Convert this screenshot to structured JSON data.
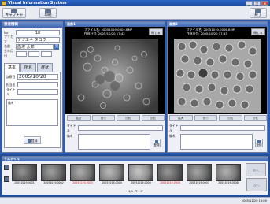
{
  "window": {
    "title": "Visual Information System",
    "buttons": {
      "minimize": "_",
      "maximize": "□",
      "close": "×"
    }
  },
  "toolbar": {
    "capture_label": "キャプチャ",
    "print_label": "印刷",
    "exit_label": "終了"
  },
  "patient": {
    "panel_title": "患者情報",
    "no_label": "No",
    "no_value": "18",
    "furigana_label": "フリガナ",
    "furigana_value": "ケツエキ タロウ",
    "name_label": "名前",
    "name_value": "血液 太郎",
    "gender": "男",
    "dob_label": "生年月日",
    "tabs": [
      "基本",
      "所見",
      "症状"
    ],
    "visit_label": "診察日",
    "visit_value": "2005/10/20",
    "physician_label": "担当医",
    "title_label": "タイトル",
    "notes_label": "備考",
    "register_label": "登録"
  },
  "image1": {
    "panel_title": "画像1",
    "filename_label": "ファイル名",
    "filename_value": "20051019-0002.BMP",
    "created_label": "作成日付",
    "created_value": "2005/10/20 17:42",
    "close_label": "閉じる",
    "controls": [
      "拡大",
      "縮小",
      "回転",
      "反転"
    ],
    "title_label": "タイトル",
    "notes_label": "備考",
    "register_label": "登録"
  },
  "image2": {
    "panel_title": "画像2",
    "filename_label": "ファイル名",
    "filename_value": "20051019-0006.BMP",
    "created_label": "作成日付",
    "created_value": "2005/10/20 17:43",
    "close_label": "閉じる",
    "controls": [
      "拡大",
      "縮小",
      "回転",
      "反転"
    ],
    "title_label": "タイトル",
    "notes_label": "備考",
    "register_label": "登録"
  },
  "thumbnails": {
    "panel_title": "サムネイル",
    "items": [
      {
        "caption": "20051019-0001",
        "highlight": false
      },
      {
        "caption": "20051019-0002",
        "highlight": false
      },
      {
        "caption": "20051019-0003",
        "highlight": true
      },
      {
        "caption": "20051019-0004",
        "highlight": false
      },
      {
        "caption": "20051019-0005",
        "highlight": false
      },
      {
        "caption": "20051019-0006",
        "highlight": true
      },
      {
        "caption": "20051019-0007",
        "highlight": false
      },
      {
        "caption": "20051019-0008",
        "highlight": false
      }
    ],
    "prev_label": "前へ",
    "next_label": "次へ",
    "pager": "1/1 ページ"
  },
  "statusbar": {
    "datetime": "2005/11/20   18:00"
  },
  "colors": {
    "background": "#1f4e9a",
    "panel_header": "#3f66b0",
    "highlight_caption": "#d01010"
  }
}
